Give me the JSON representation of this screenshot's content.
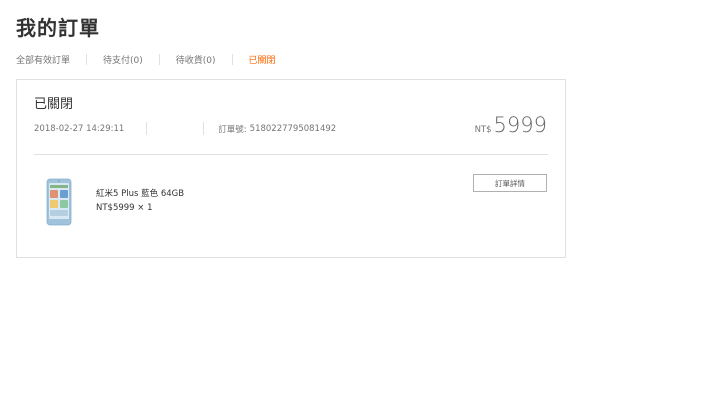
{
  "page": {
    "title": "我的訂單"
  },
  "tabs": [
    {
      "label": "全部有效訂單",
      "active": false
    },
    {
      "label": "待支付(0)",
      "active": false
    },
    {
      "label": "待收貨(0)",
      "active": false
    },
    {
      "label": "已關閉",
      "active": true
    }
  ],
  "order": {
    "status": "已關閉",
    "datetime": "2018-02-27 14:29:11",
    "order_number_label": "訂單號:",
    "order_number": "5180227795081492",
    "currency": "NT$",
    "total": "5999",
    "item": {
      "name": "紅米5 Plus 藍色 64GB",
      "price_qty": "NT$5999 × 1",
      "thumbnail_icon": "phone-icon"
    },
    "detail_button_label": "訂單詳情"
  },
  "colors": {
    "accent": "#ff6700",
    "border": "#e0e0e0",
    "phone_body": "#9ec3db"
  }
}
